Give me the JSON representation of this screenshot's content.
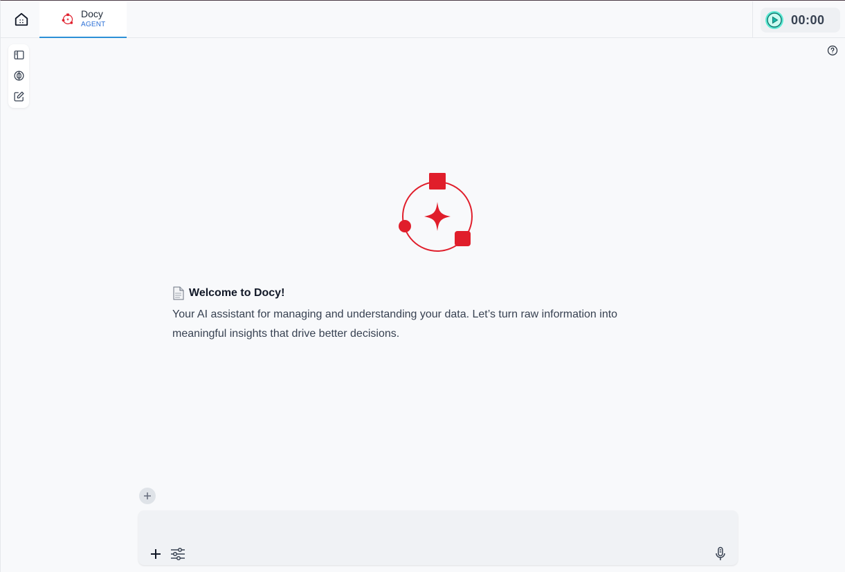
{
  "app": {
    "tab": {
      "title": "Docy",
      "subtitle": "AGENT"
    },
    "timer": {
      "value": "00:00"
    }
  },
  "welcome": {
    "title": "Welcome to Docy!",
    "body": "Your AI assistant for managing and understanding your data. Let’s turn raw information into meaningful insights that drive better decisions."
  },
  "composer": {
    "placeholder": ""
  },
  "icons": {
    "home": "home-icon",
    "tab": "docy-logo-icon",
    "timer": "play-circle-icon",
    "sidebar": [
      "sidebar-toggle-icon",
      "brain-icon",
      "edit-icon"
    ],
    "help": "help-circle-icon",
    "composer": [
      "plus-icon",
      "sliders-icon",
      "microphone-icon"
    ]
  },
  "colors": {
    "brand": "#e01e2b",
    "accent": "#2b8fd6",
    "play": "#2dd4bf"
  }
}
